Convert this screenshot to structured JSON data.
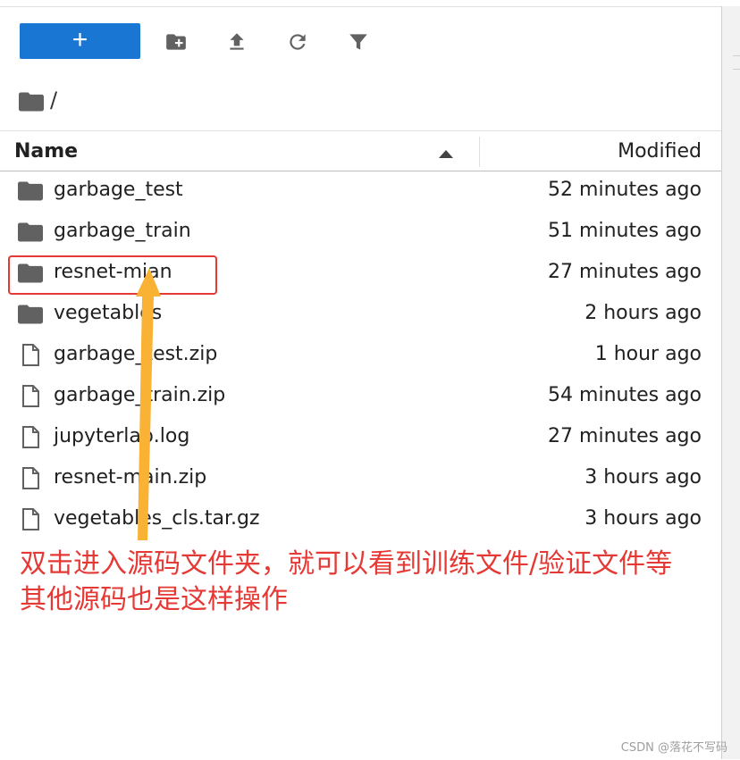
{
  "toolbar": {
    "new_label": "+",
    "icons": [
      "new-folder-icon",
      "upload-icon",
      "refresh-icon",
      "filter-icon"
    ]
  },
  "breadcrumb": {
    "root_icon": "folder-icon",
    "path": "/"
  },
  "columns": {
    "name": "Name",
    "modified": "Modified",
    "sort_icon": "sort-ascending-icon"
  },
  "files": [
    {
      "name": "garbage_test",
      "modified": "52 minutes ago",
      "type": "folder"
    },
    {
      "name": "garbage_train",
      "modified": "51 minutes ago",
      "type": "folder"
    },
    {
      "name": "resnet-mian",
      "modified": "27 minutes ago",
      "type": "folder"
    },
    {
      "name": "vegetables",
      "modified": "2 hours ago",
      "type": "folder"
    },
    {
      "name": "garbage_test.zip",
      "modified": "1 hour ago",
      "type": "file"
    },
    {
      "name": "garbage_train.zip",
      "modified": "54 minutes ago",
      "type": "file"
    },
    {
      "name": "jupyterlab.log",
      "modified": "27 minutes ago",
      "type": "file"
    },
    {
      "name": "resnet-main.zip",
      "modified": "3 hours ago",
      "type": "file"
    },
    {
      "name": "vegetables_cls.tar.gz",
      "modified": "3 hours ago",
      "type": "file"
    }
  ],
  "annotation": {
    "line1": "双击进入源码文件夹，就可以看到训练文件/验证文件等",
    "line2": "其他源码也是这样操作",
    "color": "#e53935",
    "arrow_color": "#f9b233"
  },
  "watermark": "CSDN @落花不写码",
  "colors": {
    "accent": "#1976d2",
    "icon": "#616161",
    "highlight": "#e53935"
  }
}
